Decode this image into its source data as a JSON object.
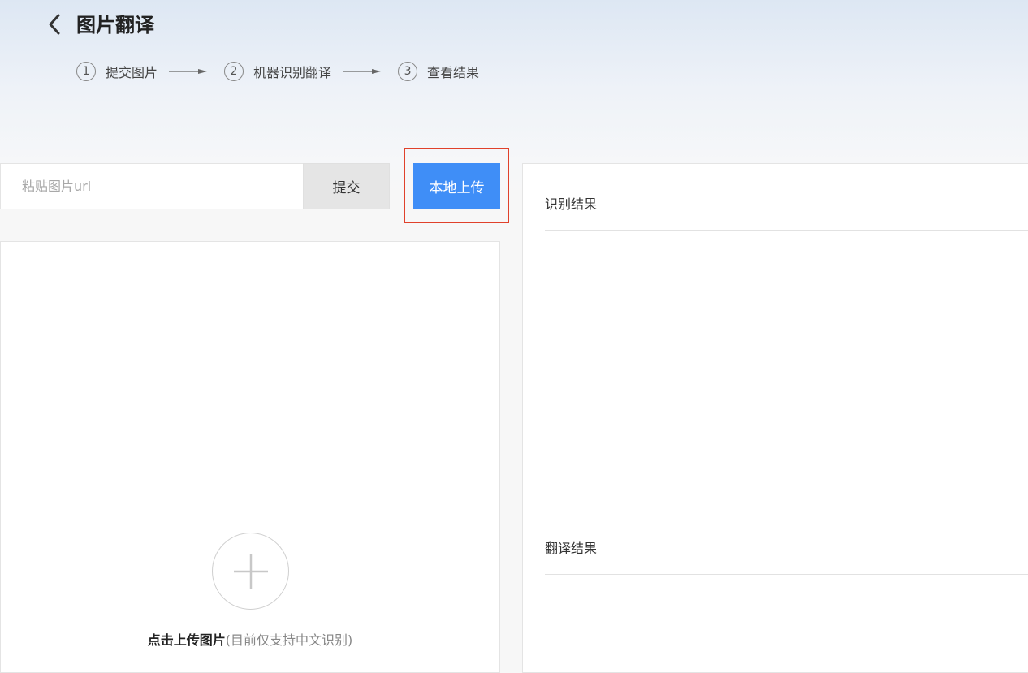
{
  "header": {
    "title": "图片翻译",
    "back_icon": "chevron-left-icon"
  },
  "steps": [
    {
      "num": "1",
      "label": "提交图片"
    },
    {
      "num": "2",
      "label": "机器识别翻译"
    },
    {
      "num": "3",
      "label": "查看结果"
    }
  ],
  "url_form": {
    "placeholder": "粘贴图片url",
    "value": "",
    "submit_label": "提交",
    "upload_label": "本地上传"
  },
  "drop_zone": {
    "action_text": "点击上传图片",
    "hint_text": "(目前仅支持中文识别)",
    "icon": "plus-icon"
  },
  "results": {
    "recognition_title": "识别结果",
    "translation_title": "翻译结果"
  },
  "colors": {
    "accent": "#3f8ef7",
    "highlight": "#e0412b"
  }
}
